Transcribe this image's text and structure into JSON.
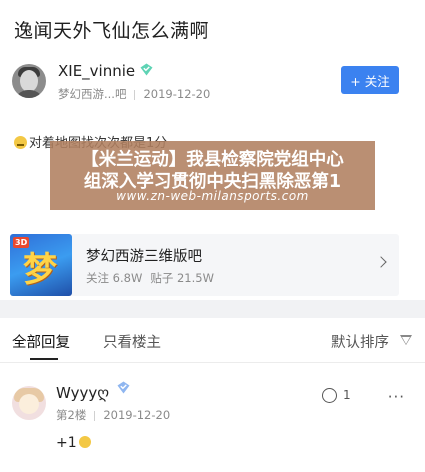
{
  "post": {
    "title": "逸闻天外飞仙怎么满啊",
    "author": {
      "name": "XIE_vinnie",
      "forum": "梦幻西游...吧",
      "date": "2019-12-20",
      "follow_label": "+ 关注"
    },
    "content": "对着地图找次次都是1分"
  },
  "overlay": {
    "line1": "【米兰运动】我县检察院党组中心",
    "line2": "组深入学习贯彻中央扫黑除恶第1",
    "url": "www.zn-web-milansports.com"
  },
  "forum_card": {
    "name": "梦幻西游三维版吧",
    "follows": "关注 6.8W",
    "posts": "贴子 21.5W",
    "icon_label": "3D",
    "icon_glyph": "梦"
  },
  "replies_bar": {
    "tab_all": "全部回复",
    "tab_op": "只看楼主",
    "sort": "默认排序"
  },
  "reply": {
    "name": "Wyyyღ",
    "floor": "第2楼",
    "date": "2019-12-20",
    "text": "+1",
    "like_count": "1",
    "more": "···"
  },
  "colors": {
    "accent": "#3b82f0",
    "overlay": "#b08060"
  },
  "icons": [
    "verified-badge-icon",
    "smile-emoji-icon",
    "chevron-right-icon",
    "filter-icon",
    "like-icon",
    "more-icon",
    "thumbs-up-emoji-icon"
  ]
}
